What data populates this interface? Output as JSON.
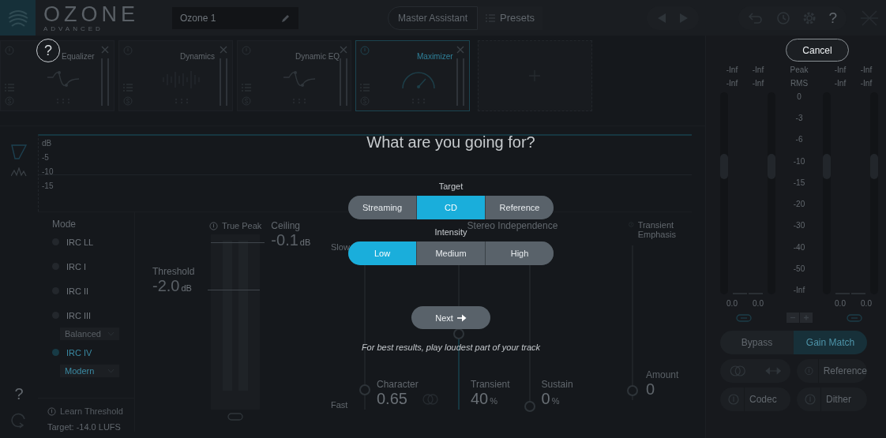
{
  "app": {
    "logo_text": "OZONE",
    "logo_subtitle": "ADVANCED"
  },
  "top_bar": {
    "preset_name": "Ozone 1",
    "assistant_button": "Master Assistant",
    "presets_button": "Presets",
    "help": "?"
  },
  "modules": [
    {
      "name": "Equalizer",
      "kind": "eq",
      "selected": false
    },
    {
      "name": "Dynamics",
      "kind": "dynamics",
      "selected": false
    },
    {
      "name": "Dynamic EQ",
      "kind": "eq",
      "selected": false
    },
    {
      "name": "Maximizer",
      "kind": "maximizer",
      "selected": true
    }
  ],
  "sidebar": {
    "help": "?"
  },
  "graph": {
    "labels": [
      "dB",
      "-5",
      "-10",
      "-15"
    ]
  },
  "mode": {
    "title": "Mode",
    "options": [
      {
        "label": "IRC LL",
        "selected": false
      },
      {
        "label": "IRC I",
        "selected": false
      },
      {
        "label": "IRC II",
        "selected": false
      },
      {
        "label": "IRC III",
        "selected": false,
        "style": "Balanced"
      },
      {
        "label": "IRC IV",
        "selected": true,
        "style": "Modern"
      }
    ],
    "learn_button": "Learn Threshold",
    "target_label": "Target:",
    "target_value": "-14.0 LUFS"
  },
  "threshold": {
    "label": "Threshold",
    "value": "-2.0",
    "unit": "dB"
  },
  "true_peak": {
    "label": "True Peak"
  },
  "ceiling": {
    "label": "Ceiling",
    "value": "-0.1",
    "unit": "dB"
  },
  "character": {
    "slow": "Slow",
    "fast": "Fast",
    "label": "Character",
    "value": "0.65",
    "level": 0.12
  },
  "stereo": {
    "title": "Stereo Independence",
    "sliders": [
      {
        "label": "Transient",
        "value": "40",
        "unit": "%",
        "level": 0.46
      },
      {
        "label": "Sustain",
        "value": "0",
        "unit": "%",
        "level": 0.02
      }
    ]
  },
  "transient_emphasis": {
    "title": "Transient Emphasis",
    "label": "Amount",
    "value": "0",
    "level": 0.03
  },
  "meters": {
    "peak_label": "Peak",
    "rms_label": "RMS",
    "peak_values": [
      "-Inf",
      "-Inf",
      "-Inf",
      "-Inf"
    ],
    "rms_values": [
      "-Inf",
      "-Inf",
      "-Inf",
      "-Inf"
    ],
    "scale": [
      "0",
      "-3",
      "-6",
      "-10",
      "-15",
      "-20",
      "-30",
      "-40",
      "-50",
      "-Inf"
    ],
    "readouts": [
      "0.0",
      "0.0",
      "0.0",
      "0.0"
    ]
  },
  "output_buttons": [
    {
      "label": "Bypass",
      "selected": false
    },
    {
      "label": "Gain Match",
      "selected": true
    }
  ],
  "tool_buttons": [
    "Reference",
    "Codec",
    "Dither"
  ],
  "dialog": {
    "help_button": "?",
    "cancel_button": "Cancel",
    "title": "What are you going for?",
    "target": {
      "label": "Target",
      "options": [
        {
          "label": "Streaming",
          "selected": false
        },
        {
          "label": "CD",
          "selected": true
        },
        {
          "label": "Reference",
          "selected": false
        }
      ]
    },
    "intensity": {
      "label": "Intensity",
      "options": [
        {
          "label": "Low",
          "selected": true
        },
        {
          "label": "Medium",
          "selected": false
        },
        {
          "label": "High",
          "selected": false
        }
      ]
    },
    "next_button": "Next",
    "note": "For best results, play loudest part of your track"
  }
}
